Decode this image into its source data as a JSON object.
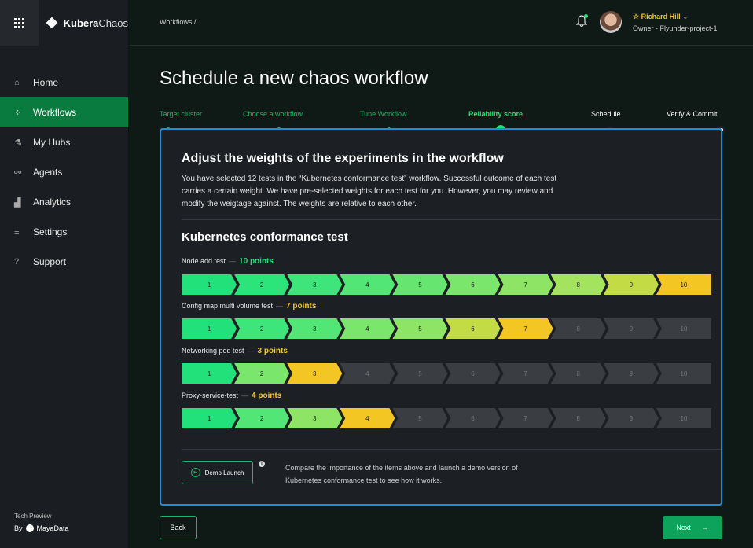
{
  "app": {
    "brand_bold": "Kubera",
    "brand_light": "Chaos"
  },
  "sidebar": {
    "items": [
      {
        "label": "Home",
        "icon": "home-icon",
        "glyph": "⌂"
      },
      {
        "label": "Workflows",
        "icon": "workflows-icon",
        "glyph": "⁘"
      },
      {
        "label": "My Hubs",
        "icon": "flask-icon",
        "glyph": "⚗"
      },
      {
        "label": "Agents",
        "icon": "link-icon",
        "glyph": "⚯"
      },
      {
        "label": "Analytics",
        "icon": "analytics-icon",
        "glyph": "▟"
      },
      {
        "label": "Settings",
        "icon": "settings-icon",
        "glyph": "≡"
      },
      {
        "label": "Support",
        "icon": "help-icon",
        "glyph": "?"
      }
    ],
    "active_index": 1,
    "footer_preview": "Tech Preview",
    "footer_by": "By",
    "footer_company": "MayaData"
  },
  "header": {
    "breadcrumb": "Workflows /",
    "user_name": "Richard Hill",
    "user_role": "Owner - Flyunder-project-1"
  },
  "page": {
    "title": "Schedule a new chaos workflow"
  },
  "stepper": {
    "steps": [
      {
        "label": "Target cluster",
        "state": "done"
      },
      {
        "label": "Choose a workflow",
        "state": "done"
      },
      {
        "label": "Tune Workflow",
        "state": "done"
      },
      {
        "label": "Reliability score",
        "state": "current"
      },
      {
        "label": "Schedule",
        "state": "future"
      },
      {
        "label": "Verify & Commit",
        "state": "future"
      }
    ]
  },
  "card": {
    "heading": "Adjust the weights of the experiments in the workflow",
    "description": "You have selected 12 tests in the “Kubernetes conformance test” workflow.  Successful outcome of each test carries a certain weight. We have pre-selected weights for each test for you. However, you may review and modify the weigtage against. The weights are relative to each other.",
    "section_title": "Kubernetes conformance test",
    "tests": [
      {
        "name": "Node add test",
        "points_label": "10 points",
        "value": 10,
        "color": "#22e07a"
      },
      {
        "name": "Config map multi volume test",
        "points_label": "7 points",
        "value": 7,
        "color": "#f3c623"
      },
      {
        "name": "Networking pod test",
        "points_label": "3 points",
        "value": 3,
        "color": "#f3c623"
      },
      {
        "name": "Proxy-service-test",
        "points_label": "4 points",
        "value": 4,
        "color": "#f3c623"
      }
    ],
    "scale": [
      "1",
      "2",
      "3",
      "4",
      "5",
      "6",
      "7",
      "8",
      "9",
      "10"
    ],
    "demo_button": "Demo Launch",
    "demo_text": "Compare the importance of the items above and launch a demo version of Kubernetes conformance test to see how it works."
  },
  "footer": {
    "back": "Back",
    "next": "Next",
    "next_arrow": "→"
  },
  "colors": {
    "accent": "#0a7b3e",
    "active_step": "#22e07a",
    "card_border": "#1e8fd6",
    "warning": "#f3c623"
  }
}
